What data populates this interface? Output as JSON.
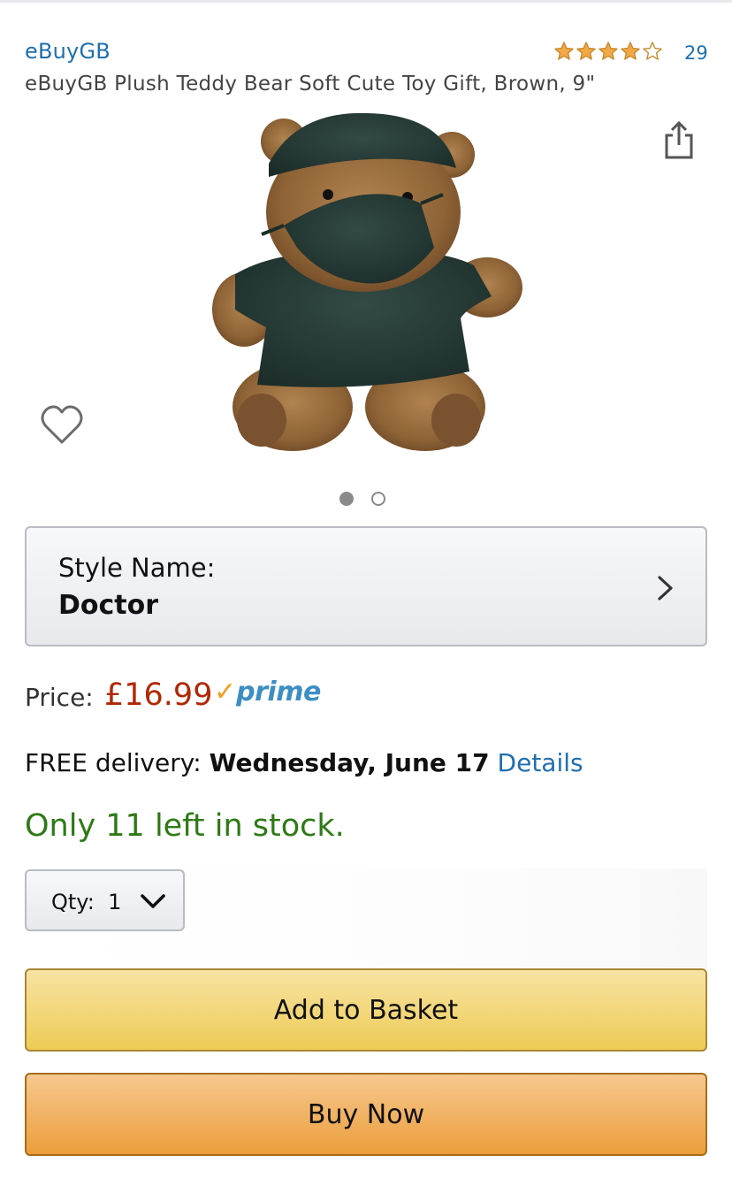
{
  "product": {
    "brand": "eBuyGB",
    "title": "eBuyGB Plush Teddy Bear Soft Cute Toy Gift, Brown, 9\"",
    "rating": {
      "stars": 4,
      "max_stars": 5,
      "review_count": "29",
      "star_color": "#f3a847"
    },
    "image": {
      "slide_count": 2,
      "active_slide": 1
    }
  },
  "style": {
    "label": "Style Name:",
    "value": "Doctor"
  },
  "price": {
    "label": "Price:",
    "value": "£16.99",
    "prime_check": "✓",
    "prime_word": "prime",
    "price_color": "#b12704"
  },
  "delivery": {
    "prefix": "FREE delivery: ",
    "date": "Wednesday, June 17",
    "details_link": "Details"
  },
  "stock": {
    "text": "Only 11 left in stock.",
    "color": "#2d7a15"
  },
  "quantity": {
    "label": "Qty:",
    "value": "1"
  },
  "actions": {
    "add_to_basket": "Add to Basket",
    "buy_now": "Buy Now"
  },
  "icons": {
    "share": "share-icon",
    "heart": "heart-icon",
    "chevron": "chevron-right-icon",
    "dropdown": "chevron-down-icon"
  }
}
